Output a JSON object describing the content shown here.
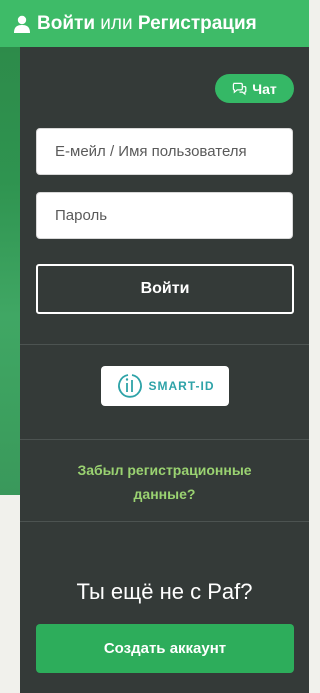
{
  "header": {
    "login_label": "Войти",
    "or_label": "или",
    "register_label": "Регистрация",
    "icon": "user-icon"
  },
  "chat": {
    "label": "Чат",
    "icon": "chat-bubbles-icon"
  },
  "form": {
    "email_placeholder": "Е-мейл / Имя пользователя",
    "password_placeholder": "Пароль",
    "submit_label": "Войти"
  },
  "smart_id": {
    "label": "SMART-ID",
    "icon": "smart-id-logo"
  },
  "forgot_label": "Забыл регистрационные данные?",
  "signup": {
    "question": "Ты ещё не с Paf?",
    "button_label": "Создать аккаунт"
  },
  "colors": {
    "brand_green": "#3ebb68",
    "panel_bg": "#343a38",
    "link_green": "#9ad271",
    "smart_id_teal": "#2ea3a8"
  }
}
